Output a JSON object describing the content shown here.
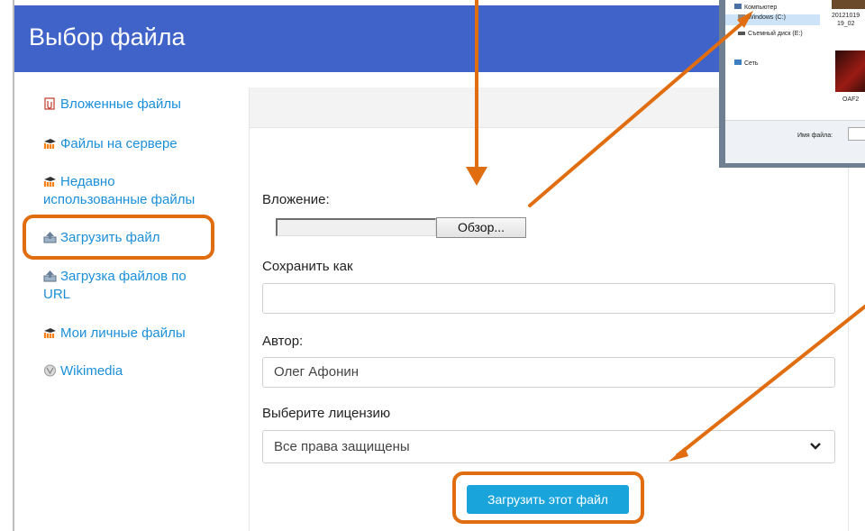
{
  "header": {
    "title": "Выбор файла"
  },
  "sidebar": {
    "items": [
      {
        "label": "Вложенные файлы",
        "icon": "attachment-icon"
      },
      {
        "label": "Файлы на сервере",
        "icon": "moodle-icon"
      },
      {
        "label": "Недавно использованные файлы",
        "line1": "Недавно",
        "line2": "использованные файлы",
        "icon": "moodle-icon"
      },
      {
        "label": "Загрузить файл",
        "icon": "upload-icon"
      },
      {
        "label": "Загрузка файлов по URL",
        "line1": "Загрузка файлов по",
        "line2": "URL",
        "icon": "upload-icon"
      },
      {
        "label": "Мои личные файлы",
        "icon": "moodle-icon"
      },
      {
        "label": "Wikimedia",
        "icon": "wikimedia-icon"
      }
    ]
  },
  "form": {
    "attachment_label": "Вложение:",
    "browse_label": "Обзор...",
    "save_as_label": "Сохранить как",
    "save_as_value": "",
    "author_label": "Автор:",
    "author_value": "Олег Афонин",
    "license_label": "Выберите лицензию",
    "license_value": "Все права защищены",
    "upload_button": "Загрузить этот файл"
  },
  "dialog": {
    "nav": [
      {
        "label": "Компьютер",
        "icon": "computer-icon"
      },
      {
        "label": "Windows (C:)",
        "icon": "drive-icon"
      },
      {
        "label": "Съемный диск (E:)",
        "icon": "removable-drive-icon"
      },
      {
        "label": "Сеть",
        "icon": "network-icon"
      }
    ],
    "thumb1_line1": "20121019",
    "thumb1_line2": "19_02",
    "thumb2_label": "OAF2",
    "filename_label": "Имя файла:"
  },
  "colors": {
    "header": "#3f63c8",
    "link": "#1a8fd9",
    "accent": "#e06d10",
    "button": "#1aa4dc"
  }
}
